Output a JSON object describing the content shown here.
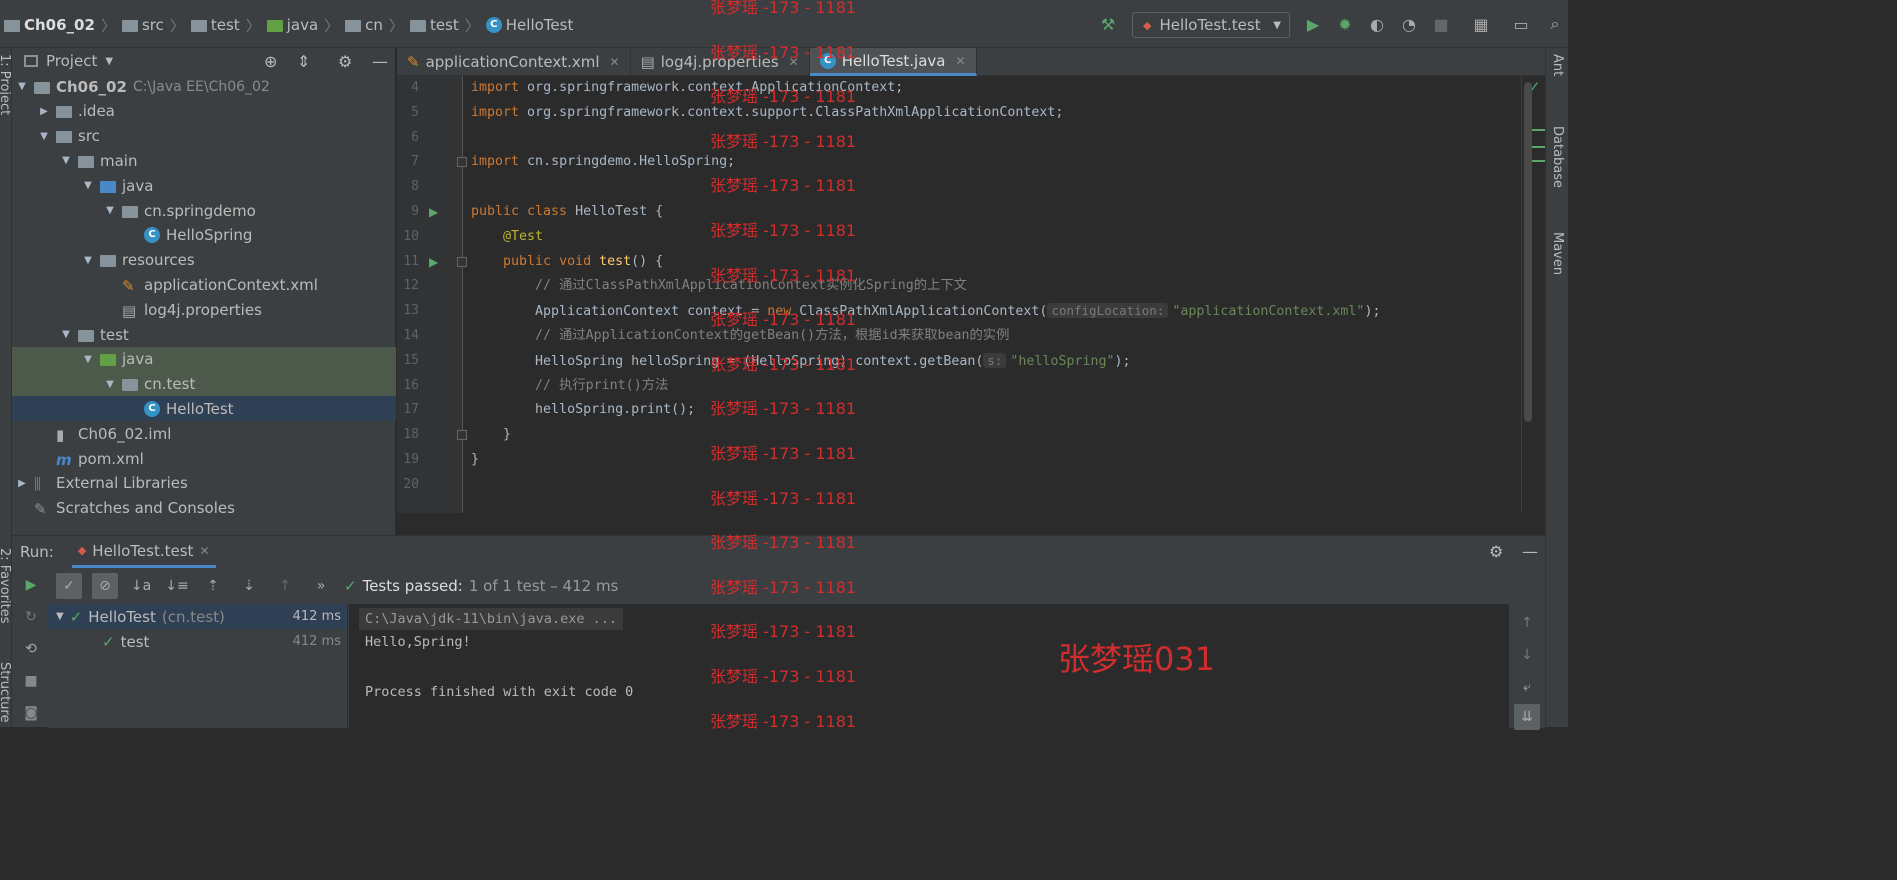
{
  "breadcrumb": [
    {
      "label": "Ch06_02",
      "icon": "folder-icon",
      "bold": true
    },
    {
      "label": "src",
      "icon": "folder-icon"
    },
    {
      "label": "test",
      "icon": "folder-icon"
    },
    {
      "label": "java",
      "icon": "folder-green-icon"
    },
    {
      "label": "cn",
      "icon": "package-icon"
    },
    {
      "label": "test",
      "icon": "package-icon"
    },
    {
      "label": "HelloTest",
      "icon": "class-icon"
    }
  ],
  "run_config": {
    "label": "HelloTest.test"
  },
  "project_panel": {
    "title": "Project",
    "tree": [
      {
        "label": "Ch06_02",
        "extra": "C:\\Java EE\\Ch06_02",
        "depth": 0,
        "arrow": "▼",
        "icon": "folder",
        "bold": true
      },
      {
        "label": ".idea",
        "depth": 1,
        "arrow": "▶",
        "icon": "folder"
      },
      {
        "label": "src",
        "depth": 1,
        "arrow": "▼",
        "icon": "folder"
      },
      {
        "label": "main",
        "depth": 2,
        "arrow": "▼",
        "icon": "folder"
      },
      {
        "label": "java",
        "depth": 3,
        "arrow": "▼",
        "icon": "folder-blue"
      },
      {
        "label": "cn.springdemo",
        "depth": 4,
        "arrow": "▼",
        "icon": "package"
      },
      {
        "label": "HelloSpring",
        "depth": 5,
        "arrow": "",
        "icon": "class"
      },
      {
        "label": "resources",
        "depth": 3,
        "arrow": "▼",
        "icon": "folder-res"
      },
      {
        "label": "applicationContext.xml",
        "depth": 4,
        "arrow": "",
        "icon": "xml"
      },
      {
        "label": "log4j.properties",
        "depth": 4,
        "arrow": "",
        "icon": "props"
      },
      {
        "label": "test",
        "depth": 2,
        "arrow": "▼",
        "icon": "folder"
      },
      {
        "label": "java",
        "depth": 3,
        "arrow": "▼",
        "icon": "folder-green",
        "selected": "green"
      },
      {
        "label": "cn.test",
        "depth": 4,
        "arrow": "▼",
        "icon": "package",
        "selected": "green"
      },
      {
        "label": "HelloTest",
        "depth": 5,
        "arrow": "",
        "icon": "class",
        "selected": "blue"
      },
      {
        "label": "Ch06_02.iml",
        "depth": 1,
        "arrow": "",
        "icon": "iml"
      },
      {
        "label": "pom.xml",
        "depth": 1,
        "arrow": "",
        "icon": "maven"
      },
      {
        "label": "External Libraries",
        "depth": 0,
        "arrow": "▶",
        "icon": "libs"
      },
      {
        "label": "Scratches and Consoles",
        "depth": 0,
        "arrow": "",
        "icon": "scratch"
      }
    ]
  },
  "editor_tabs": [
    {
      "label": "applicationContext.xml",
      "active": false
    },
    {
      "label": "log4j.properties",
      "active": false
    },
    {
      "label": "HelloTest.java",
      "active": true
    }
  ],
  "code_lines": [
    {
      "n": "4",
      "html": "<span class=\"kw\">import</span> org.springframework.context.ApplicationContext;"
    },
    {
      "n": "5",
      "html": "<span class=\"kw\">import</span> org.springframework.context.support.ClassPathXmlApplicationContext;"
    },
    {
      "n": "6",
      "html": ""
    },
    {
      "n": "7",
      "html": "<span class=\"kw\">import</span> cn.springdemo.HelloSpring;"
    },
    {
      "n": "8",
      "html": ""
    },
    {
      "n": "9",
      "html": "<span class=\"kw\">public class</span> HelloTest {"
    },
    {
      "n": "10",
      "html": "    <span class=\"ann\">@Test</span>"
    },
    {
      "n": "11",
      "html": "    <span class=\"kw\">public void</span> <span class=\"fn\">test</span>() {"
    },
    {
      "n": "12",
      "html": "        <span class=\"cmt\">// 通过ClassPathXmlApplicationContext实例化Spring的上下文</span>"
    },
    {
      "n": "13",
      "html": "        ApplicationContext context = <span class=\"kw\">new</span> ClassPathXmlApplicationContext(<span class=\"hint\">configLocation:</span><span class=\"str\">\"applicationContext.xml\"</span>);"
    },
    {
      "n": "14",
      "html": "        <span class=\"cmt\">// 通过ApplicationContext的getBean()方法，根据id来获取bean的实例</span>"
    },
    {
      "n": "15",
      "html": "        HelloSpring helloSpring = (HelloSpring) context.getBean(<span class=\"hint\">s:</span><span class=\"str\">\"helloSpring\"</span>);"
    },
    {
      "n": "16",
      "html": "        <span class=\"cmt\">// 执行print()方法</span>"
    },
    {
      "n": "17",
      "html": "        helloSpring.print();"
    },
    {
      "n": "18",
      "html": "    }"
    },
    {
      "n": "19",
      "html": "}"
    },
    {
      "n": "20",
      "html": ""
    }
  ],
  "run_panel": {
    "label": "Run:",
    "tab": "HelloTest.test",
    "status_prefix": "Tests passed:",
    "status_detail": "1 of 1 test – 412 ms",
    "results": [
      {
        "name": "HelloTest",
        "suffix": "(cn.test)",
        "time": "412 ms"
      },
      {
        "name": "test",
        "suffix": "",
        "time": "412 ms"
      }
    ],
    "console": [
      "C:\\Java\\jdk-11\\bin\\java.exe ...",
      "Hello,Spring!",
      "",
      "Process finished with exit code 0"
    ]
  },
  "side_tools": {
    "left": [
      "1: Project",
      "2: Favorites",
      "Structure"
    ],
    "right": [
      "Ant",
      "Database",
      "Maven"
    ]
  },
  "watermark": {
    "repeat": "张梦瑶 -173 - 1181",
    "signature": "张梦瑶031"
  },
  "colors": {
    "accent": "#4a88c7",
    "pass": "#59a869",
    "watermark": "#d12d2d"
  }
}
